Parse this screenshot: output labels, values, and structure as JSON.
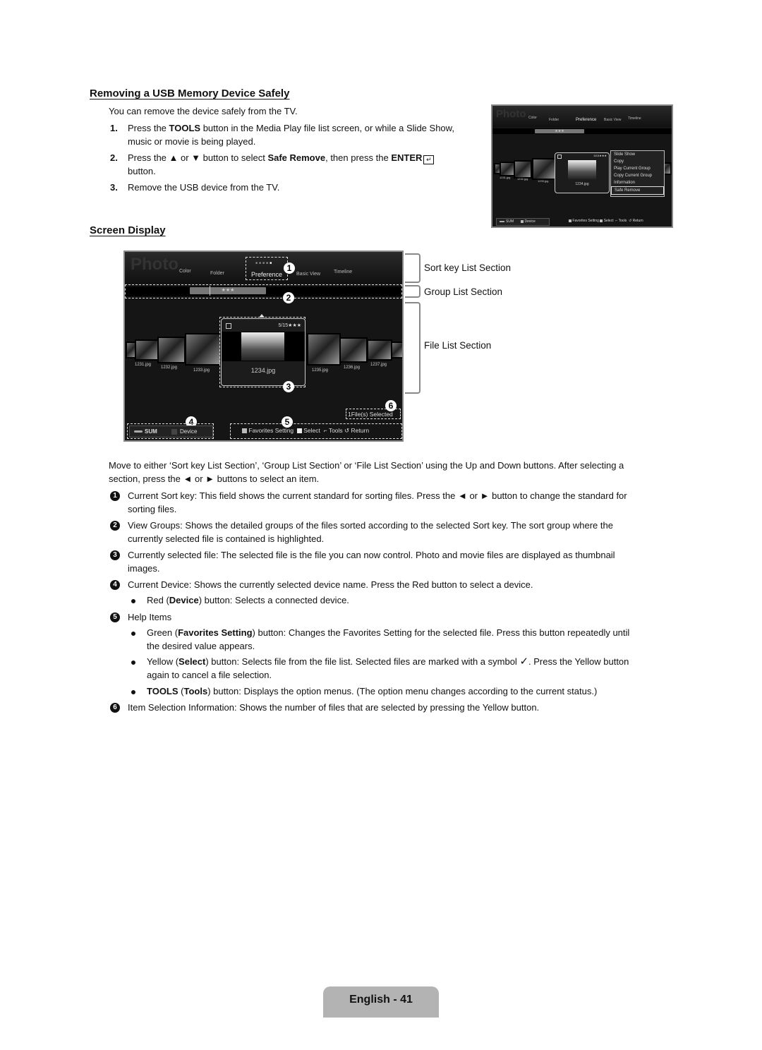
{
  "section1": {
    "title": "Removing a USB Memory Device Safely",
    "intro": "You can remove the device safely from the TV.",
    "steps": [
      {
        "num": "1.",
        "pre": "Press the ",
        "bold": "TOOLS",
        "post": " button in the Media Play file list screen, or while a Slide Show,",
        "line2": "music or movie is being played."
      },
      {
        "num": "2.",
        "pre": "Press the ▲ or ▼ button to select ",
        "bold": "Safe Remove",
        "mid": ", then press the ",
        "bold2": "ENTER",
        "icon": "enter-icon",
        "line2": "button."
      },
      {
        "num": "3.",
        "text": "Remove the USB device from the TV."
      }
    ]
  },
  "small_screen": {
    "title": "Photo",
    "tabs": [
      "Color",
      "Folder",
      "Preference",
      "Basic View",
      "Timeline"
    ],
    "group_label": "★★★",
    "files": [
      "1231.jpg",
      "1232.jpg",
      "1233.jpg",
      "1234.jpg"
    ],
    "selected_counter": "5/15★★★",
    "menu": [
      "Slide Show",
      "Copy",
      "Play Current Group",
      "Copy Current Group",
      "Information",
      "Safe Remove"
    ],
    "menu_selected": "Safe Remove",
    "device": {
      "sum": "SUM",
      "device": "Device"
    },
    "help": [
      "Favorites Setting",
      "Select",
      "Tools",
      "Return"
    ]
  },
  "section2": {
    "title": "Screen Display"
  },
  "big_screen": {
    "title": "Photo",
    "tabs": [
      "Color",
      "Folder",
      "Preference",
      "Basic View",
      "Timeline"
    ],
    "group_label": "★★★",
    "files_left": [
      "1231.jpg",
      "1232.jpg",
      "1233.jpg"
    ],
    "selected_file": "1234.jpg",
    "selected_counter": "5/15★★★",
    "files_right": [
      "1235.jpg",
      "1236.jpg",
      "1237.jpg"
    ],
    "selection_info": "1File(s) Selected",
    "device": {
      "sum": "SUM",
      "device": "Device"
    },
    "help": [
      "Favorites Setting",
      "Select",
      "Tools",
      "Return"
    ],
    "callouts": [
      "1",
      "2",
      "3",
      "4",
      "5",
      "6"
    ]
  },
  "brackets": [
    "Sort key List Section",
    "Group List Section",
    "File List Section"
  ],
  "description": {
    "intro_l1": "Move to either ‘Sort key List Section’, ‘Group List Section’ or ‘File List Section’ using the Up and Down buttons. After selecting a",
    "intro_l2": "section, press the ◄ or ► buttons to select an item.",
    "items": [
      {
        "n": "1",
        "l1": "Current Sort key: This field shows the current standard for sorting files. Press the ◄ or ► button to change the standard for",
        "l2": "sorting files."
      },
      {
        "n": "2",
        "l1": "View Groups: Shows the detailed groups of the files sorted according to the selected Sort key. The sort group where the",
        "l2": "currently selected file is contained is highlighted."
      },
      {
        "n": "3",
        "l1": "Currently selected file: The selected file is the file you can now control. Photo and movie files are displayed as thumbnail",
        "l2": "images."
      },
      {
        "n": "4",
        "l1": "Current Device: Shows the currently selected device name. Press the Red button to select a device."
      },
      {
        "n": "5",
        "l1": "Help Items"
      },
      {
        "n": "6",
        "l1": "Item Selection Information: Shows the number of files that are selected by pressing the Yellow button."
      }
    ],
    "bullets": {
      "red": {
        "pre": "Red (",
        "bold": "Device",
        "post": ") button: Selects a connected device."
      },
      "green": {
        "pre": "Green (",
        "bold": "Favorites Setting",
        "post": ") button: Changes the Favorites Setting for the selected file. Press this button repeatedly until",
        "l2": "the desired value appears."
      },
      "yellow": {
        "pre": "Yellow (",
        "bold": "Select",
        "post": ") button: Selects file from the file list. Selected files are marked with a symbol ",
        "post2": ". Press the Yellow button",
        "l2": "again to cancel a file selection."
      },
      "tools": {
        "bold": "TOOLS",
        "pre": " (",
        "bold2": "Tools",
        "post": ") button: Displays the option menus. (The option menu changes according to the current status.)"
      }
    }
  },
  "page_footer": "English - 41"
}
